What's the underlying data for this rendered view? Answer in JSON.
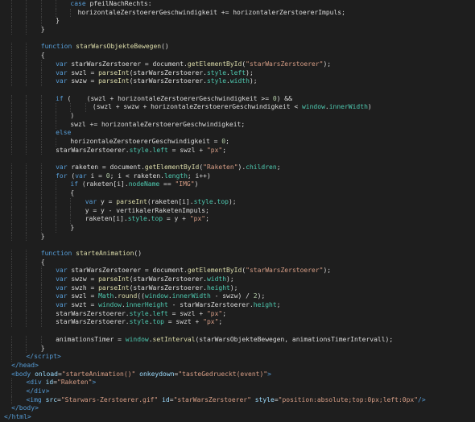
{
  "editor": {
    "lines": [
      {
        "indent": 9,
        "tokens": [
          [
            "kw",
            "case"
          ],
          [
            "plain",
            " pfeilNachRechts:"
          ]
        ]
      },
      {
        "indent": 10,
        "tokens": [
          [
            "plain",
            "horizontaleZerstoererGeschwindigkeit += horizontalerZerstoererImpuls;"
          ]
        ]
      },
      {
        "indent": 7,
        "tokens": [
          [
            "plain",
            "}"
          ]
        ]
      },
      {
        "indent": 5,
        "tokens": [
          [
            "plain",
            "}"
          ]
        ]
      },
      {
        "indent": 0,
        "tokens": []
      },
      {
        "indent": 5,
        "tokens": [
          [
            "kw",
            "function"
          ],
          [
            "plain",
            " "
          ],
          [
            "fn",
            "starWarsObjekteBewegen"
          ],
          [
            "plain",
            "()"
          ]
        ]
      },
      {
        "indent": 5,
        "tokens": [
          [
            "plain",
            "{"
          ]
        ]
      },
      {
        "indent": 7,
        "tokens": [
          [
            "kw",
            "var"
          ],
          [
            "plain",
            " starWarsZerstoerer = "
          ],
          [
            "obj",
            "document"
          ],
          [
            "plain",
            "."
          ],
          [
            "fn",
            "getElementById"
          ],
          [
            "plain",
            "("
          ],
          [
            "str",
            "\"starWarsZerstoerer\""
          ],
          [
            "plain",
            ");"
          ]
        ]
      },
      {
        "indent": 7,
        "tokens": [
          [
            "kw",
            "var"
          ],
          [
            "plain",
            " swzl = "
          ],
          [
            "fn",
            "parseInt"
          ],
          [
            "plain",
            "(starWarsZerstoerer."
          ],
          [
            "prop",
            "style"
          ],
          [
            "plain",
            "."
          ],
          [
            "prop",
            "left"
          ],
          [
            "plain",
            ");"
          ]
        ]
      },
      {
        "indent": 7,
        "tokens": [
          [
            "kw",
            "var"
          ],
          [
            "plain",
            " swzw = "
          ],
          [
            "fn",
            "parseInt"
          ],
          [
            "plain",
            "(starWarsZerstoerer."
          ],
          [
            "prop",
            "style"
          ],
          [
            "plain",
            "."
          ],
          [
            "prop",
            "width"
          ],
          [
            "plain",
            ");"
          ]
        ]
      },
      {
        "indent": 0,
        "tokens": []
      },
      {
        "indent": 7,
        "tokens": [
          [
            "kw",
            "if"
          ],
          [
            "plain",
            " (    (swzl + horizontaleZerstoererGeschwindigkeit >= "
          ],
          [
            "num",
            "0"
          ],
          [
            "plain",
            ") &&"
          ]
        ]
      },
      {
        "indent": 12,
        "tokens": [
          [
            "plain",
            "(swzl + swzw + horizontaleZerstoererGeschwindigkeit < "
          ],
          [
            "prop",
            "window"
          ],
          [
            "plain",
            "."
          ],
          [
            "prop",
            "innerWidth"
          ],
          [
            "plain",
            ")"
          ]
        ]
      },
      {
        "indent": 9,
        "tokens": [
          [
            "plain",
            ")"
          ]
        ]
      },
      {
        "indent": 9,
        "tokens": [
          [
            "plain",
            "swzl += horizontaleZerstoererGeschwindigkeit;"
          ]
        ]
      },
      {
        "indent": 7,
        "tokens": [
          [
            "kw",
            "else"
          ]
        ]
      },
      {
        "indent": 9,
        "tokens": [
          [
            "plain",
            "horizontaleZerstoererGeschwindigkeit = "
          ],
          [
            "num",
            "0"
          ],
          [
            "plain",
            ";"
          ]
        ]
      },
      {
        "indent": 7,
        "tokens": [
          [
            "plain",
            "starWarsZerstoerer."
          ],
          [
            "prop",
            "style"
          ],
          [
            "plain",
            "."
          ],
          [
            "prop",
            "left"
          ],
          [
            "plain",
            " = swzl + "
          ],
          [
            "str",
            "\"px\""
          ],
          [
            "plain",
            ";"
          ]
        ]
      },
      {
        "indent": 0,
        "tokens": []
      },
      {
        "indent": 7,
        "tokens": [
          [
            "kw",
            "var"
          ],
          [
            "plain",
            " raketen = "
          ],
          [
            "obj",
            "document"
          ],
          [
            "plain",
            "."
          ],
          [
            "fn",
            "getElementById"
          ],
          [
            "plain",
            "("
          ],
          [
            "str",
            "\"Raketen\""
          ],
          [
            "plain",
            ")."
          ],
          [
            "prop",
            "children"
          ],
          [
            "plain",
            ";"
          ]
        ]
      },
      {
        "indent": 7,
        "tokens": [
          [
            "kw",
            "for"
          ],
          [
            "plain",
            " ("
          ],
          [
            "kw",
            "var"
          ],
          [
            "plain",
            " i = "
          ],
          [
            "num",
            "0"
          ],
          [
            "plain",
            "; i < raketen."
          ],
          [
            "prop",
            "length"
          ],
          [
            "plain",
            "; i++)"
          ]
        ]
      },
      {
        "indent": 9,
        "tokens": [
          [
            "kw",
            "if"
          ],
          [
            "plain",
            " (raketen[i]."
          ],
          [
            "prop",
            "nodeName"
          ],
          [
            "plain",
            " == "
          ],
          [
            "str",
            "\"IMG\""
          ],
          [
            "plain",
            ")"
          ]
        ]
      },
      {
        "indent": 9,
        "tokens": [
          [
            "plain",
            "{"
          ]
        ]
      },
      {
        "indent": 11,
        "tokens": [
          [
            "kw",
            "var"
          ],
          [
            "plain",
            " y = "
          ],
          [
            "fn",
            "parseInt"
          ],
          [
            "plain",
            "(raketen[i]."
          ],
          [
            "prop",
            "style"
          ],
          [
            "plain",
            "."
          ],
          [
            "prop",
            "top"
          ],
          [
            "plain",
            ");"
          ]
        ]
      },
      {
        "indent": 11,
        "tokens": [
          [
            "plain",
            "y = y - vertikalerRaketenImpuls;"
          ]
        ]
      },
      {
        "indent": 11,
        "tokens": [
          [
            "plain",
            "raketen[i]."
          ],
          [
            "prop",
            "style"
          ],
          [
            "plain",
            "."
          ],
          [
            "prop",
            "top"
          ],
          [
            "plain",
            " = y + "
          ],
          [
            "str",
            "\"px\""
          ],
          [
            "plain",
            ";"
          ]
        ]
      },
      {
        "indent": 9,
        "tokens": [
          [
            "plain",
            "}"
          ]
        ]
      },
      {
        "indent": 5,
        "tokens": [
          [
            "plain",
            "}"
          ]
        ]
      },
      {
        "indent": 0,
        "tokens": []
      },
      {
        "indent": 5,
        "tokens": [
          [
            "kw",
            "function"
          ],
          [
            "plain",
            " "
          ],
          [
            "fn",
            "starteAnimation"
          ],
          [
            "plain",
            "()"
          ]
        ]
      },
      {
        "indent": 5,
        "tokens": [
          [
            "plain",
            "{"
          ]
        ]
      },
      {
        "indent": 7,
        "tokens": [
          [
            "kw",
            "var"
          ],
          [
            "plain",
            " starWarsZerstoerer = "
          ],
          [
            "obj",
            "document"
          ],
          [
            "plain",
            "."
          ],
          [
            "fn",
            "getElementById"
          ],
          [
            "plain",
            "("
          ],
          [
            "str",
            "\"starWarsZerstoerer\""
          ],
          [
            "plain",
            ");"
          ]
        ]
      },
      {
        "indent": 7,
        "tokens": [
          [
            "kw",
            "var"
          ],
          [
            "plain",
            " swzw = "
          ],
          [
            "fn",
            "parseInt"
          ],
          [
            "plain",
            "(starWarsZerstoerer."
          ],
          [
            "prop",
            "width"
          ],
          [
            "plain",
            ");"
          ]
        ]
      },
      {
        "indent": 7,
        "tokens": [
          [
            "kw",
            "var"
          ],
          [
            "plain",
            " swzh = "
          ],
          [
            "fn",
            "parseInt"
          ],
          [
            "plain",
            "(starWarsZerstoerer."
          ],
          [
            "prop",
            "height"
          ],
          [
            "plain",
            ");"
          ]
        ]
      },
      {
        "indent": 7,
        "tokens": [
          [
            "kw",
            "var"
          ],
          [
            "plain",
            " swzl = "
          ],
          [
            "prop",
            "Math"
          ],
          [
            "plain",
            "."
          ],
          [
            "fn",
            "round"
          ],
          [
            "plain",
            "(("
          ],
          [
            "prop",
            "window"
          ],
          [
            "plain",
            "."
          ],
          [
            "prop",
            "innerWidth"
          ],
          [
            "plain",
            " - swzw) / "
          ],
          [
            "num",
            "2"
          ],
          [
            "plain",
            ");"
          ]
        ]
      },
      {
        "indent": 7,
        "tokens": [
          [
            "kw",
            "var"
          ],
          [
            "plain",
            " swzt = "
          ],
          [
            "prop",
            "window"
          ],
          [
            "plain",
            "."
          ],
          [
            "prop",
            "innerHeight"
          ],
          [
            "plain",
            " - starWarsZerstoerer."
          ],
          [
            "prop",
            "height"
          ],
          [
            "plain",
            ";"
          ]
        ]
      },
      {
        "indent": 7,
        "tokens": [
          [
            "plain",
            "starWarsZerstoerer."
          ],
          [
            "prop",
            "style"
          ],
          [
            "plain",
            "."
          ],
          [
            "prop",
            "left"
          ],
          [
            "plain",
            " = swzl + "
          ],
          [
            "str",
            "\"px\""
          ],
          [
            "plain",
            ";"
          ]
        ]
      },
      {
        "indent": 7,
        "tokens": [
          [
            "plain",
            "starWarsZerstoerer."
          ],
          [
            "prop",
            "style"
          ],
          [
            "plain",
            "."
          ],
          [
            "prop",
            "top"
          ],
          [
            "plain",
            " = swzt + "
          ],
          [
            "str",
            "\"px\""
          ],
          [
            "plain",
            ";"
          ]
        ]
      },
      {
        "indent": 0,
        "tokens": []
      },
      {
        "indent": 7,
        "tokens": [
          [
            "plain",
            "animationsTimer = "
          ],
          [
            "prop",
            "window"
          ],
          [
            "plain",
            "."
          ],
          [
            "fn",
            "setInterval"
          ],
          [
            "plain",
            "(starWarsObjekteBewegen, animationsTimerIntervall);"
          ]
        ]
      },
      {
        "indent": 5,
        "tokens": [
          [
            "plain",
            "}"
          ]
        ]
      },
      {
        "indent": 3,
        "tokens": [
          [
            "tag",
            "</"
          ],
          [
            "tagname",
            "script"
          ],
          [
            "tag",
            ">"
          ]
        ]
      },
      {
        "indent": 1,
        "tokens": [
          [
            "tag",
            "</"
          ],
          [
            "tagname",
            "head"
          ],
          [
            "tag",
            ">"
          ]
        ]
      },
      {
        "indent": 1,
        "tokens": [
          [
            "tag",
            "<"
          ],
          [
            "tagname",
            "body"
          ],
          [
            "plain",
            " "
          ],
          [
            "attr",
            "onload"
          ],
          [
            "plain",
            "="
          ],
          [
            "attrval",
            "\"starteAnimation()\""
          ],
          [
            "plain",
            " "
          ],
          [
            "attr",
            "onkeydown"
          ],
          [
            "plain",
            "="
          ],
          [
            "attrval",
            "\"tasteGedrueckt(event)\""
          ],
          [
            "tag",
            ">"
          ]
        ]
      },
      {
        "indent": 3,
        "tokens": [
          [
            "tag",
            "<"
          ],
          [
            "tagname",
            "div"
          ],
          [
            "plain",
            " "
          ],
          [
            "attr",
            "id"
          ],
          [
            "plain",
            "="
          ],
          [
            "attrval",
            "\"Raketen\""
          ],
          [
            "tag",
            ">"
          ]
        ]
      },
      {
        "indent": 3,
        "tokens": [
          [
            "tag",
            "</"
          ],
          [
            "tagname",
            "div"
          ],
          [
            "tag",
            ">"
          ]
        ]
      },
      {
        "indent": 3,
        "tokens": [
          [
            "tag",
            "<"
          ],
          [
            "tagname",
            "img"
          ],
          [
            "plain",
            " "
          ],
          [
            "attr",
            "src"
          ],
          [
            "plain",
            "="
          ],
          [
            "attrval",
            "\"Starwars-Zerstoerer.gif\""
          ],
          [
            "plain",
            " "
          ],
          [
            "attr",
            "id"
          ],
          [
            "plain",
            "="
          ],
          [
            "attrval",
            "\"starWarsZerstoerer\""
          ],
          [
            "plain",
            " "
          ],
          [
            "attr",
            "style"
          ],
          [
            "plain",
            "="
          ],
          [
            "attrval",
            "\"position:absolute;top:0px;left:0px\""
          ],
          [
            "tag",
            "/>"
          ]
        ]
      },
      {
        "indent": 1,
        "tokens": [
          [
            "tag",
            "</"
          ],
          [
            "tagname",
            "body"
          ],
          [
            "tag",
            ">"
          ]
        ]
      },
      {
        "indent": 0,
        "tokens": [
          [
            "tag",
            "</"
          ],
          [
            "tagname",
            "html"
          ],
          [
            "tag",
            ">"
          ]
        ]
      }
    ]
  }
}
